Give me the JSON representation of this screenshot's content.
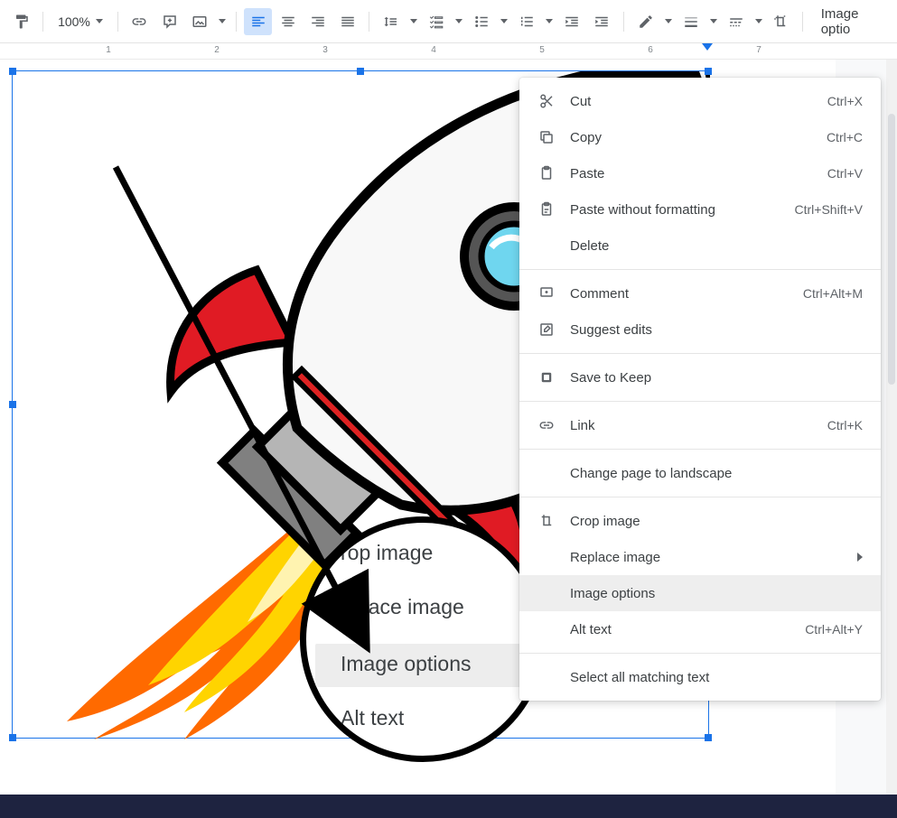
{
  "toolbar": {
    "zoom": "100%",
    "image_options_label": "Image optio"
  },
  "ruler": {
    "marks": [
      "1",
      "2",
      "3",
      "4",
      "5",
      "6",
      "7"
    ]
  },
  "context_menu": {
    "cut": {
      "label": "Cut",
      "shortcut": "Ctrl+X"
    },
    "copy": {
      "label": "Copy",
      "shortcut": "Ctrl+C"
    },
    "paste": {
      "label": "Paste",
      "shortcut": "Ctrl+V"
    },
    "paste_nf": {
      "label": "Paste without formatting",
      "shortcut": "Ctrl+Shift+V"
    },
    "delete": {
      "label": "Delete"
    },
    "comment": {
      "label": "Comment",
      "shortcut": "Ctrl+Alt+M"
    },
    "suggest": {
      "label": "Suggest edits"
    },
    "keep": {
      "label": "Save to Keep"
    },
    "link": {
      "label": "Link",
      "shortcut": "Ctrl+K"
    },
    "landscape": {
      "label": "Change page to landscape"
    },
    "crop": {
      "label": "Crop image"
    },
    "replace": {
      "label": "Replace image"
    },
    "imgopts": {
      "label": "Image options"
    },
    "alt": {
      "label": "Alt text",
      "shortcut": "Ctrl+Alt+Y"
    },
    "selectall": {
      "label": "Select all matching text"
    }
  },
  "magnifier": {
    "crop": "rop image",
    "replace": "eplace image",
    "imgopts": "Image options",
    "alt": "Alt text"
  }
}
